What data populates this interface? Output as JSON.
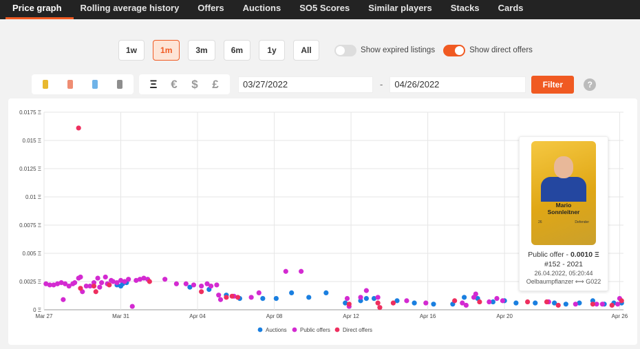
{
  "tabs": [
    {
      "label": "Price graph",
      "active": true
    },
    {
      "label": "Rolling average history"
    },
    {
      "label": "Offers"
    },
    {
      "label": "Auctions"
    },
    {
      "label": "SO5 Scores"
    },
    {
      "label": "Similar players"
    },
    {
      "label": "Stacks"
    },
    {
      "label": "Cards"
    }
  ],
  "ranges": [
    {
      "label": "1w"
    },
    {
      "label": "1m",
      "active": true
    },
    {
      "label": "3m"
    },
    {
      "label": "6m"
    },
    {
      "label": "1y"
    },
    {
      "label": "All"
    }
  ],
  "toggles": {
    "expired": {
      "label": "Show expired listings",
      "on": false
    },
    "direct": {
      "label": "Show direct offers",
      "on": true
    }
  },
  "rarities": [
    "#e8b82f",
    "#ef8d73",
    "#6fb3e8",
    "#8e8e8e"
  ],
  "currencies": [
    "Ξ",
    "€",
    "$",
    "£"
  ],
  "dates": {
    "from": "03/27/2022",
    "sep": "-",
    "to": "04/26/2022"
  },
  "filter_label": "Filter",
  "help_label": "?",
  "colors": {
    "auctions": "#1a7fe0",
    "public": "#d32ad1",
    "direct": "#ee2f5f",
    "accent": "#f05a22"
  },
  "tooltip": {
    "card_name": "Mario\nSonnleitner",
    "stat1": "26",
    "stat2": "Defender",
    "offer_prefix": "Public offer - ",
    "offer_value": "0.0010 Ξ",
    "serial": "#152 - 2021",
    "date": "26.04.2022, 05:20:44",
    "trade": "Oelbaumpflanzer ⟺ G022"
  },
  "chart_data": {
    "type": "scatter",
    "x_labels": [
      "Mar 27",
      "Mar 31",
      "Apr 04",
      "Apr 08",
      "Apr 12",
      "Apr 16",
      "Apr 20",
      "Apr 26"
    ],
    "x_label_days": [
      0,
      4,
      8,
      12,
      16,
      20,
      24,
      30
    ],
    "y_ticks": [
      "0 Ξ",
      "0.0025 Ξ",
      "0.005 Ξ",
      "0.0075 Ξ",
      "0.01 Ξ",
      "0.0125 Ξ",
      "0.015 Ξ",
      "0.0175 Ξ"
    ],
    "ylim": [
      0,
      0.0175
    ],
    "xlim_days": [
      0,
      30.2
    ],
    "legend": [
      "Auctions",
      "Public offers",
      "Direct offers"
    ],
    "series": [
      {
        "name": "Auctions",
        "points": [
          [
            3.8,
            0.0022
          ],
          [
            4.0,
            0.0021
          ],
          [
            4.1,
            0.0023
          ],
          [
            4.3,
            0.0024
          ],
          [
            7.6,
            0.002
          ],
          [
            8.6,
            0.0018
          ],
          [
            9.5,
            0.0013
          ],
          [
            10.2,
            0.001
          ],
          [
            11.4,
            0.001
          ],
          [
            12.1,
            0.001
          ],
          [
            12.9,
            0.0015
          ],
          [
            13.8,
            0.0011
          ],
          [
            14.7,
            0.0015
          ],
          [
            15.7,
            0.0006
          ],
          [
            16.5,
            0.0008
          ],
          [
            16.8,
            0.001
          ],
          [
            17.2,
            0.001
          ],
          [
            18.4,
            0.0008
          ],
          [
            19.3,
            0.0006
          ],
          [
            20.3,
            0.0005
          ],
          [
            21.3,
            0.0005
          ],
          [
            21.9,
            0.0011
          ],
          [
            22.6,
            0.001
          ],
          [
            23.4,
            0.0007
          ],
          [
            24.0,
            0.0008
          ],
          [
            24.6,
            0.0006
          ],
          [
            25.6,
            0.0006
          ],
          [
            26.6,
            0.0006
          ],
          [
            27.2,
            0.0005
          ],
          [
            27.9,
            0.0006
          ],
          [
            28.6,
            0.0008
          ],
          [
            29.2,
            0.0005
          ],
          [
            29.7,
            0.0006
          ],
          [
            30.1,
            0.0006
          ]
        ]
      },
      {
        "name": "Public offers",
        "points": [
          [
            0.1,
            0.0023
          ],
          [
            0.3,
            0.0022
          ],
          [
            0.5,
            0.0022
          ],
          [
            0.7,
            0.0023
          ],
          [
            0.9,
            0.0024
          ],
          [
            1.0,
            0.0009
          ],
          [
            1.1,
            0.0023
          ],
          [
            1.3,
            0.0021
          ],
          [
            1.5,
            0.0023
          ],
          [
            1.6,
            0.0024
          ],
          [
            1.8,
            0.0028
          ],
          [
            1.9,
            0.0029
          ],
          [
            2.0,
            0.0016
          ],
          [
            2.2,
            0.0021
          ],
          [
            2.4,
            0.0021
          ],
          [
            2.6,
            0.0024
          ],
          [
            2.8,
            0.0028
          ],
          [
            2.9,
            0.002
          ],
          [
            3.0,
            0.0024
          ],
          [
            3.2,
            0.0029
          ],
          [
            3.3,
            0.0023
          ],
          [
            3.5,
            0.0026
          ],
          [
            3.6,
            0.0025
          ],
          [
            3.8,
            0.0024
          ],
          [
            4.0,
            0.0026
          ],
          [
            4.2,
            0.0025
          ],
          [
            4.4,
            0.0027
          ],
          [
            4.6,
            0.0003
          ],
          [
            4.8,
            0.0026
          ],
          [
            5.0,
            0.0027
          ],
          [
            5.2,
            0.0028
          ],
          [
            5.4,
            0.0027
          ],
          [
            6.3,
            0.0027
          ],
          [
            6.9,
            0.0023
          ],
          [
            7.4,
            0.0023
          ],
          [
            7.8,
            0.0022
          ],
          [
            8.2,
            0.0021
          ],
          [
            8.5,
            0.0023
          ],
          [
            8.7,
            0.0021
          ],
          [
            9.0,
            0.0022
          ],
          [
            9.1,
            0.0013
          ],
          [
            9.2,
            0.0009
          ],
          [
            9.9,
            0.0012
          ],
          [
            10.8,
            0.0011
          ],
          [
            11.2,
            0.0015
          ],
          [
            12.6,
            0.0034
          ],
          [
            13.4,
            0.0034
          ],
          [
            15.8,
            0.001
          ],
          [
            15.9,
            0.0003
          ],
          [
            16.5,
            0.0011
          ],
          [
            16.8,
            0.0017
          ],
          [
            17.4,
            0.0011
          ],
          [
            18.9,
            0.0008
          ],
          [
            19.9,
            0.0006
          ],
          [
            21.8,
            0.0006
          ],
          [
            22.0,
            0.0004
          ],
          [
            22.4,
            0.0011
          ],
          [
            22.5,
            0.0014
          ],
          [
            23.2,
            0.0007
          ],
          [
            23.6,
            0.001
          ],
          [
            23.9,
            0.0008
          ],
          [
            26.3,
            0.0007
          ],
          [
            27.7,
            0.0005
          ],
          [
            28.8,
            0.0005
          ],
          [
            29.1,
            0.0005
          ],
          [
            30.0,
            0.001
          ],
          [
            29.9,
            0.0005
          ]
        ]
      },
      {
        "name": "Direct offers",
        "points": [
          [
            1.8,
            0.0161
          ],
          [
            1.9,
            0.0019
          ],
          [
            2.6,
            0.0021
          ],
          [
            2.7,
            0.0016
          ],
          [
            3.4,
            0.0022
          ],
          [
            5.5,
            0.0025
          ],
          [
            8.2,
            0.0016
          ],
          [
            9.5,
            0.0011
          ],
          [
            9.8,
            0.0012
          ],
          [
            10.1,
            0.0011
          ],
          [
            15.9,
            0.0005
          ],
          [
            17.4,
            0.0006
          ],
          [
            17.5,
            0.0002
          ],
          [
            18.2,
            0.0006
          ],
          [
            21.4,
            0.0008
          ],
          [
            22.7,
            0.0007
          ],
          [
            25.2,
            0.0007
          ],
          [
            26.2,
            0.0007
          ],
          [
            26.8,
            0.0004
          ],
          [
            28.6,
            0.0005
          ],
          [
            29.6,
            0.0004
          ],
          [
            30.1,
            0.0008
          ]
        ]
      }
    ]
  }
}
